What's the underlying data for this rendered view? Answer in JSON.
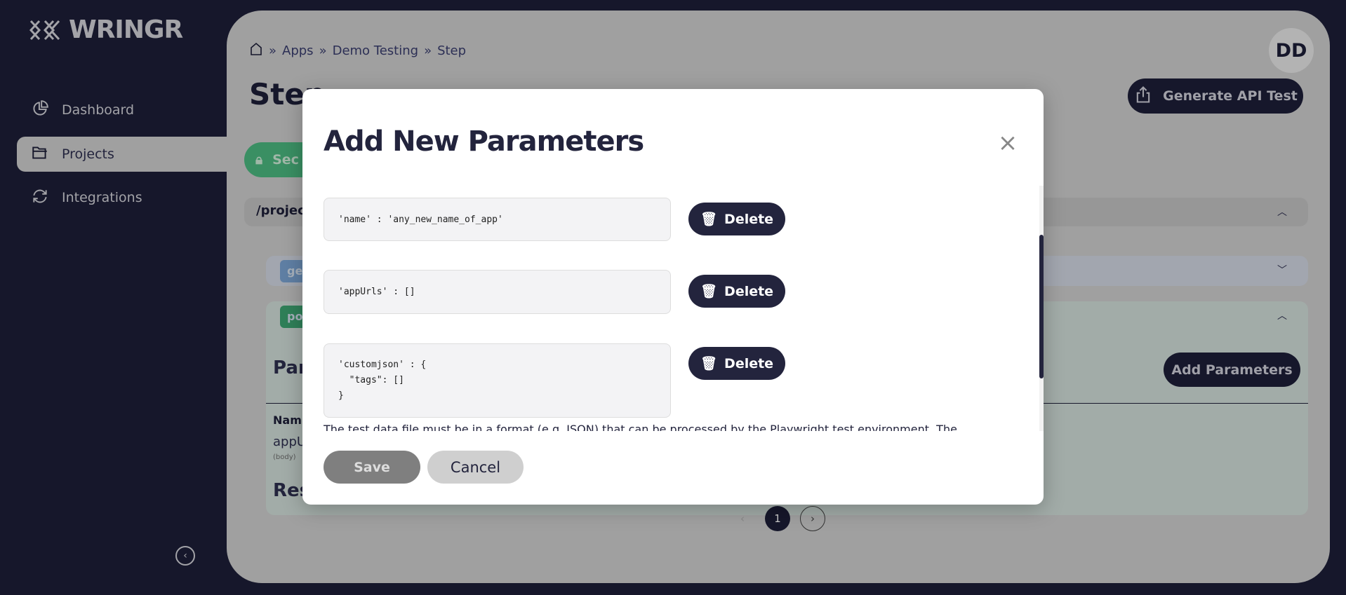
{
  "app": {
    "brand": "WRINGR"
  },
  "sidebar": {
    "items": [
      {
        "label": "Dashboard",
        "icon": "pie-chart-icon"
      },
      {
        "label": "Projects",
        "icon": "folder-icon",
        "active": true
      },
      {
        "label": "Integrations",
        "icon": "refresh-icon"
      }
    ]
  },
  "header": {
    "breadcrumb": [
      "Apps",
      "Demo Testing",
      "Step"
    ],
    "title": "Step",
    "avatar": "DD",
    "generate_label": "Generate API Test"
  },
  "background": {
    "secure_label": "Sec",
    "path": "/project",
    "tag_get": "ge",
    "tag_post": "po",
    "params_heading": "Par",
    "name_label": "Nam",
    "param_value": "appU",
    "param_location": "(body)",
    "response_heading": "Res",
    "add_params_label": "Add Parameters",
    "page": "1"
  },
  "modal": {
    "title": "Add New Parameters",
    "params": [
      "'name' : 'any_new_name_of_app'",
      "'appUrls' : []",
      "'customjson' : {\n  \"tags\": []\n}"
    ],
    "delete_label": "Delete",
    "description": "The test data file must be in a format (e.g. JSON) that can be processed by the Playwright test environment. The",
    "save_label": "Save",
    "cancel_label": "Cancel"
  },
  "colors": {
    "sidebar": "#16172b",
    "accent": "#23243d",
    "green": "#3a8f63"
  }
}
